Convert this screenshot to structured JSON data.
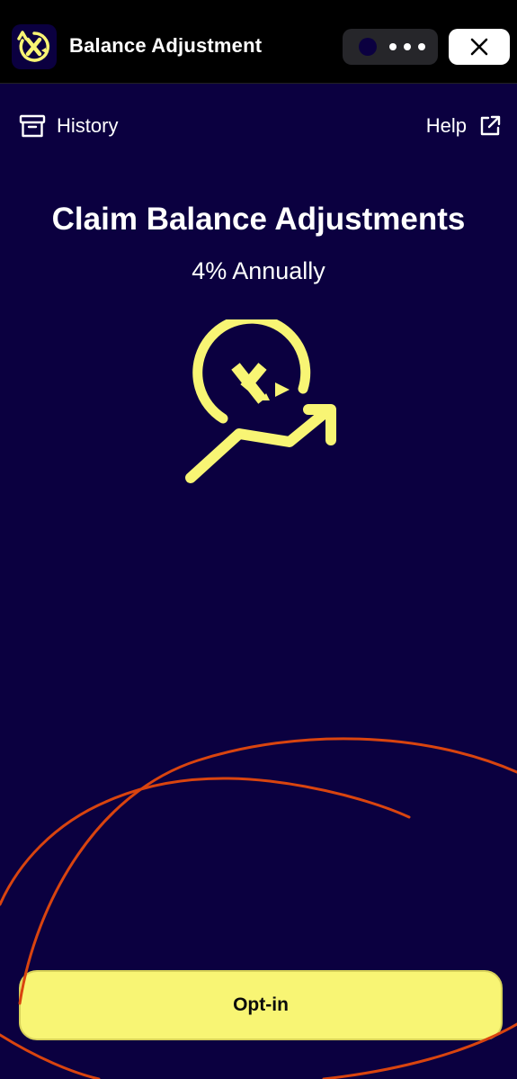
{
  "header": {
    "title": "Balance Adjustment",
    "app_icon": "x-coin-rotate-icon",
    "more_icon": "ellipsis-icon",
    "close_icon": "close-icon"
  },
  "nav": {
    "history_label": "History",
    "history_icon": "archive-box-icon",
    "help_label": "Help",
    "help_icon": "external-link-icon"
  },
  "main": {
    "headline": "Claim Balance Adjustments",
    "rate": "4% Annually",
    "hero_icon": "x-growth-arrow-icon"
  },
  "actions": {
    "optin_label": "Opt-in"
  },
  "colors": {
    "background": "#0b0040",
    "accent_yellow": "#f8f574",
    "topbar": "#000000",
    "annotation_stroke": "#e0440e"
  }
}
